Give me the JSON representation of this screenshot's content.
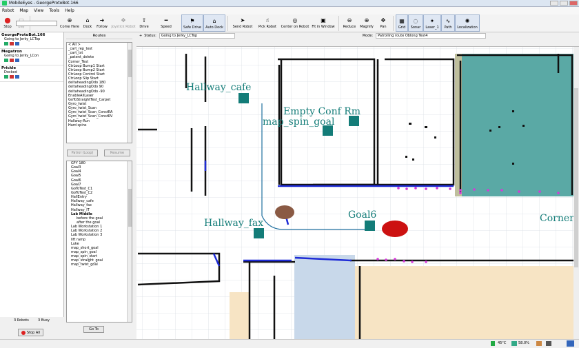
{
  "window": {
    "title": "MobileEyes - GeorgeProtoBot.166"
  },
  "menu": [
    "Robot",
    "Map",
    "View",
    "Tools",
    "Help"
  ],
  "toolbar": {
    "items": [
      {
        "id": "stop",
        "label": "Stop",
        "icon": "stop-icon"
      },
      {
        "id": "bay",
        "label": "Bay",
        "icon": "bay-icon",
        "disabled": true
      },
      {
        "id": "come-here",
        "label": "Come Here",
        "icon": "come-here-icon"
      },
      {
        "id": "dock",
        "label": "Dock",
        "icon": "dock-icon"
      },
      {
        "id": "follow",
        "label": "Follow",
        "icon": "follow-icon"
      },
      {
        "id": "joystick",
        "label": "Joystick Robot",
        "icon": "joystick-icon",
        "disabled": true
      },
      {
        "id": "drive",
        "label": "Drive",
        "icon": "drive-icon"
      },
      {
        "id": "speed",
        "label": "Speed",
        "icon": "speed-icon"
      },
      {
        "id": "safe-drive",
        "label": "Safe Drive",
        "icon": "safe-drive-icon",
        "pressed": true
      },
      {
        "id": "auto-dock",
        "label": "Auto Dock",
        "icon": "auto-dock-icon",
        "pressed": true
      },
      {
        "id": "send-robot",
        "label": "Send Robot",
        "icon": "send-robot-icon"
      },
      {
        "id": "pick-robot",
        "label": "Pick Robot",
        "icon": "pick-robot-icon"
      },
      {
        "id": "center-on-robot",
        "label": "Center on Robot",
        "icon": "center-icon"
      },
      {
        "id": "fit-in-window",
        "label": "Fit in Window",
        "icon": "fit-window-icon"
      },
      {
        "id": "reduce",
        "label": "Reduce",
        "icon": "reduce-icon"
      },
      {
        "id": "magnify",
        "label": "Magnify",
        "icon": "magnify-icon"
      },
      {
        "id": "pan",
        "label": "Pan",
        "icon": "pan-icon"
      },
      {
        "id": "grid",
        "label": "Grid",
        "icon": "grid-icon",
        "pressed": true
      },
      {
        "id": "sonar",
        "label": "Sonar",
        "icon": "sonar-icon",
        "pressed": true
      },
      {
        "id": "laser",
        "label": "Laser_1",
        "icon": "laser-icon",
        "pressed": true
      },
      {
        "id": "path",
        "label": "Path",
        "icon": "path-icon",
        "pressed": true
      },
      {
        "id": "localization",
        "label": "Localization",
        "icon": "localization-icon",
        "pressed": true
      }
    ]
  },
  "robots": [
    {
      "name": "GeorgeProtoBot.166",
      "status": "Going to Jerky_LCTop"
    },
    {
      "name": "Megatron",
      "status": "Going to Jerky_LCon"
    },
    {
      "name": "Prickle",
      "status": "Docked"
    }
  ],
  "robot_summary": {
    "count": "3 Robots",
    "busy": "3 Busy"
  },
  "stop_all_label": "Stop All",
  "routes": {
    "header": "Routes",
    "items": [
      "< All >",
      "_cart_rep_test",
      "_cart_tst",
      "_patent_delete",
      "Corner_Test",
      "CtrLoop Bump1 Start",
      "CtrLoop Bump2 Start",
      "CtrLoop Control Start",
      "CtrLoop Slip Start",
      "deltaheadingOdo 180",
      "deltaheadingOdo 90",
      "deltaheadingOdo -90",
      "EnableAllLaser",
      "GoToStraightTest_Carpet",
      "Gyro_twist",
      "Gyro_twist_Scan",
      "Gyro_twist_Scan_ConstRA",
      "Gyro_twist_Scan_ConstRV",
      "Hallway-Run",
      "Hard spins"
    ],
    "patrol_label": "Patrol (Loop)",
    "resume_label": "Resume"
  },
  "goals": {
    "items": [
      "GFY 180",
      "Goal3",
      "Goal4",
      "Goal5",
      "Goal6",
      "Goal7",
      "GoToTest_C1",
      "GoToTest_C2",
      "HallEntry",
      "Hallway_cafe",
      "Hallway_fax",
      "Hallway_IT",
      "Lab Middle",
      "before the goal",
      "after the goal",
      "Lab Workstation 1",
      "Lab Workstation 2",
      "Lab Workstation 3",
      "lift ramp",
      "Luke",
      "map_short_goal",
      "map_spin_goal",
      "map_spin_start",
      "map_straight_goal",
      "map_twist_goal"
    ],
    "goto_label": "Go To"
  },
  "status": {
    "status_label": "Status",
    "status_value": "Going to Jerky_LCTop",
    "mode_label": "Mode",
    "mode_value": "Patrolling route Oblong Test4"
  },
  "map_labels": [
    {
      "text": "Hallway_cafe"
    },
    {
      "text": "Empty Conf Rm"
    },
    {
      "text": "map_spin_goal"
    },
    {
      "text": "Goal6"
    },
    {
      "text": "Hallway_fax"
    },
    {
      "text": "Cornering"
    }
  ],
  "bottom": {
    "temperature": "45°C",
    "battery": "58.0%"
  },
  "colors": {
    "goal_marker": "#137c78",
    "robot_main": "#cc1111",
    "robot_other": "#8a5a44",
    "laser": "#1e2bd6",
    "sonar": "#d43ad8",
    "teal_zone": "#5aa9a5",
    "blue_zone": "#c8d8ea",
    "tan_zone": "#f7e4c4"
  }
}
